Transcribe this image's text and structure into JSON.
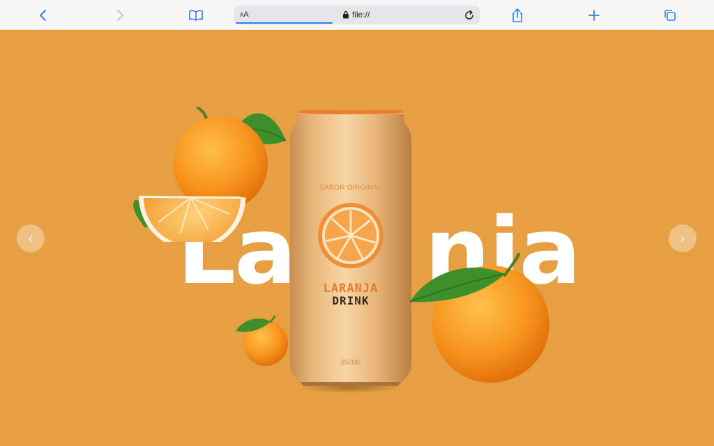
{
  "browser": {
    "text_size_label": "AA",
    "url": "file://",
    "load_progress": 0.4
  },
  "hero": {
    "big_word_left": "La",
    "big_word_right": "nja",
    "prev_glyph": "‹",
    "next_glyph": "›",
    "background_color": "#e6a043"
  },
  "can": {
    "flavor": "SABOR ORIGINAL",
    "brand_line1": "LARANJA",
    "brand_line2": "DRINK",
    "volume": "350ML"
  },
  "icons": [
    "back-icon",
    "forward-icon",
    "bookmarks-icon",
    "lock-icon",
    "reload-icon",
    "share-icon",
    "new-tab-icon",
    "tabs-icon"
  ]
}
